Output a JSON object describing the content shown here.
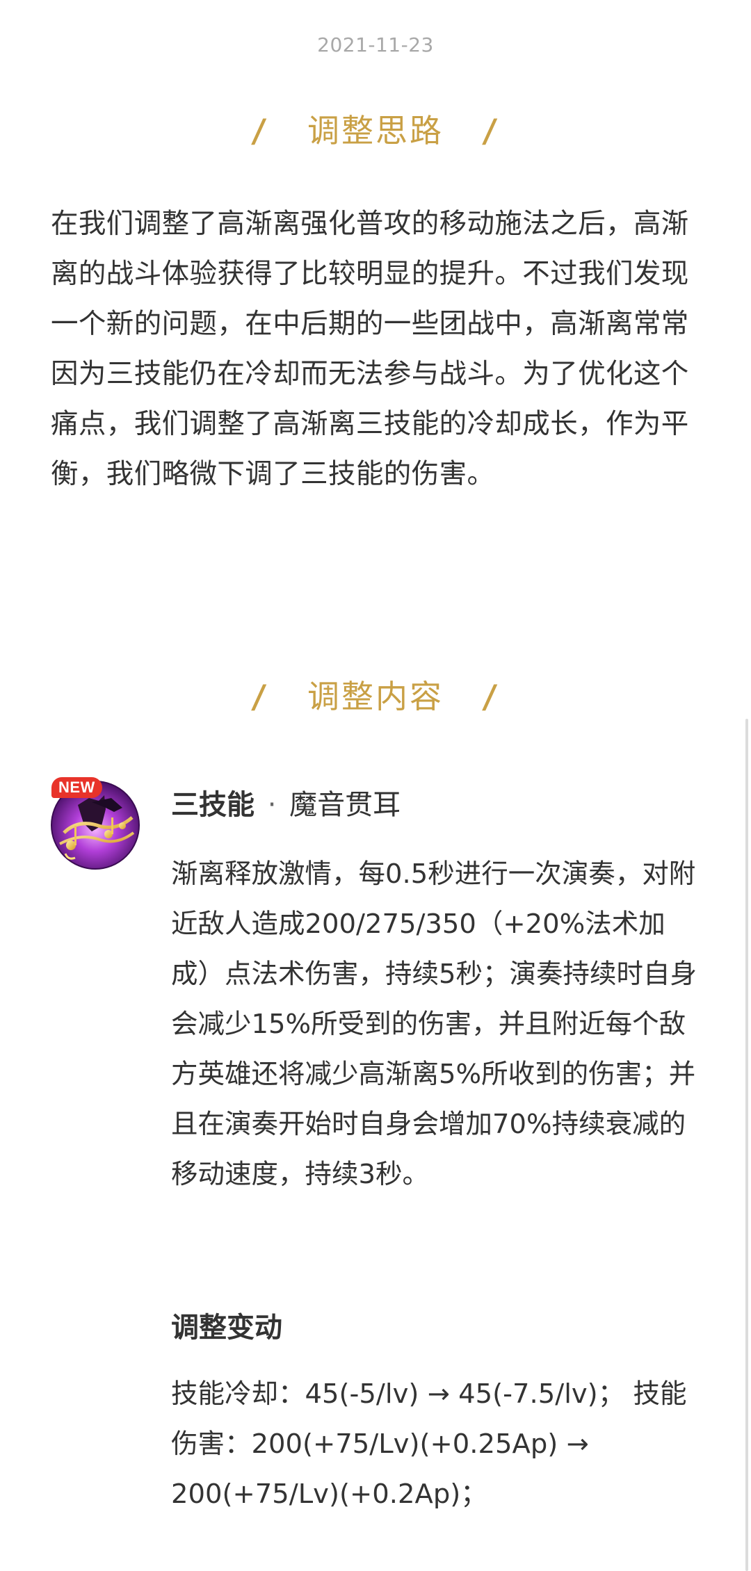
{
  "date": "2021-11-23",
  "section1": {
    "title": "调整思路",
    "paragraph": "在我们调整了高渐离强化普攻的移动施法之后，高渐离的战斗体验获得了比较明显的提升。不过我们发现一个新的问题，在中后期的一些团战中，高渐离常常因为三技能仍在冷却而无法参与战斗。为了优化这个痛点，我们调整了高渐离三技能的冷却成长，作为平衡，我们略微下调了三技能的伤害。"
  },
  "section2": {
    "title": "调整内容"
  },
  "skill": {
    "badge": "NEW",
    "icon_name": "skill-music-icon",
    "name": "三技能",
    "separator": "·",
    "subtitle": "魔音贯耳",
    "description": "渐离释放激情，每0.5秒进行一次演奏，对附近敌人造成200/275/350（+20%法术加成）点法术伤害，持续5秒；演奏持续时自身会减少15%所受到的伤害，并且附近每个敌方英雄还将减少高渐离5%所收到的伤害；并且在演奏开始时自身会增加70%持续衰减的移动速度，持续3秒。",
    "change_title": "调整变动",
    "change_text": "技能冷却：45(-5/lv) → 45(-7.5/lv)； 技能伤害：200(+75/Lv)(+0.25Ap) → 200(+75/Lv)(+0.2Ap)；"
  },
  "colors": {
    "accent": "#c9a045",
    "text": "#333333",
    "date": "#a8a8a8",
    "badge": "#e8332a"
  }
}
